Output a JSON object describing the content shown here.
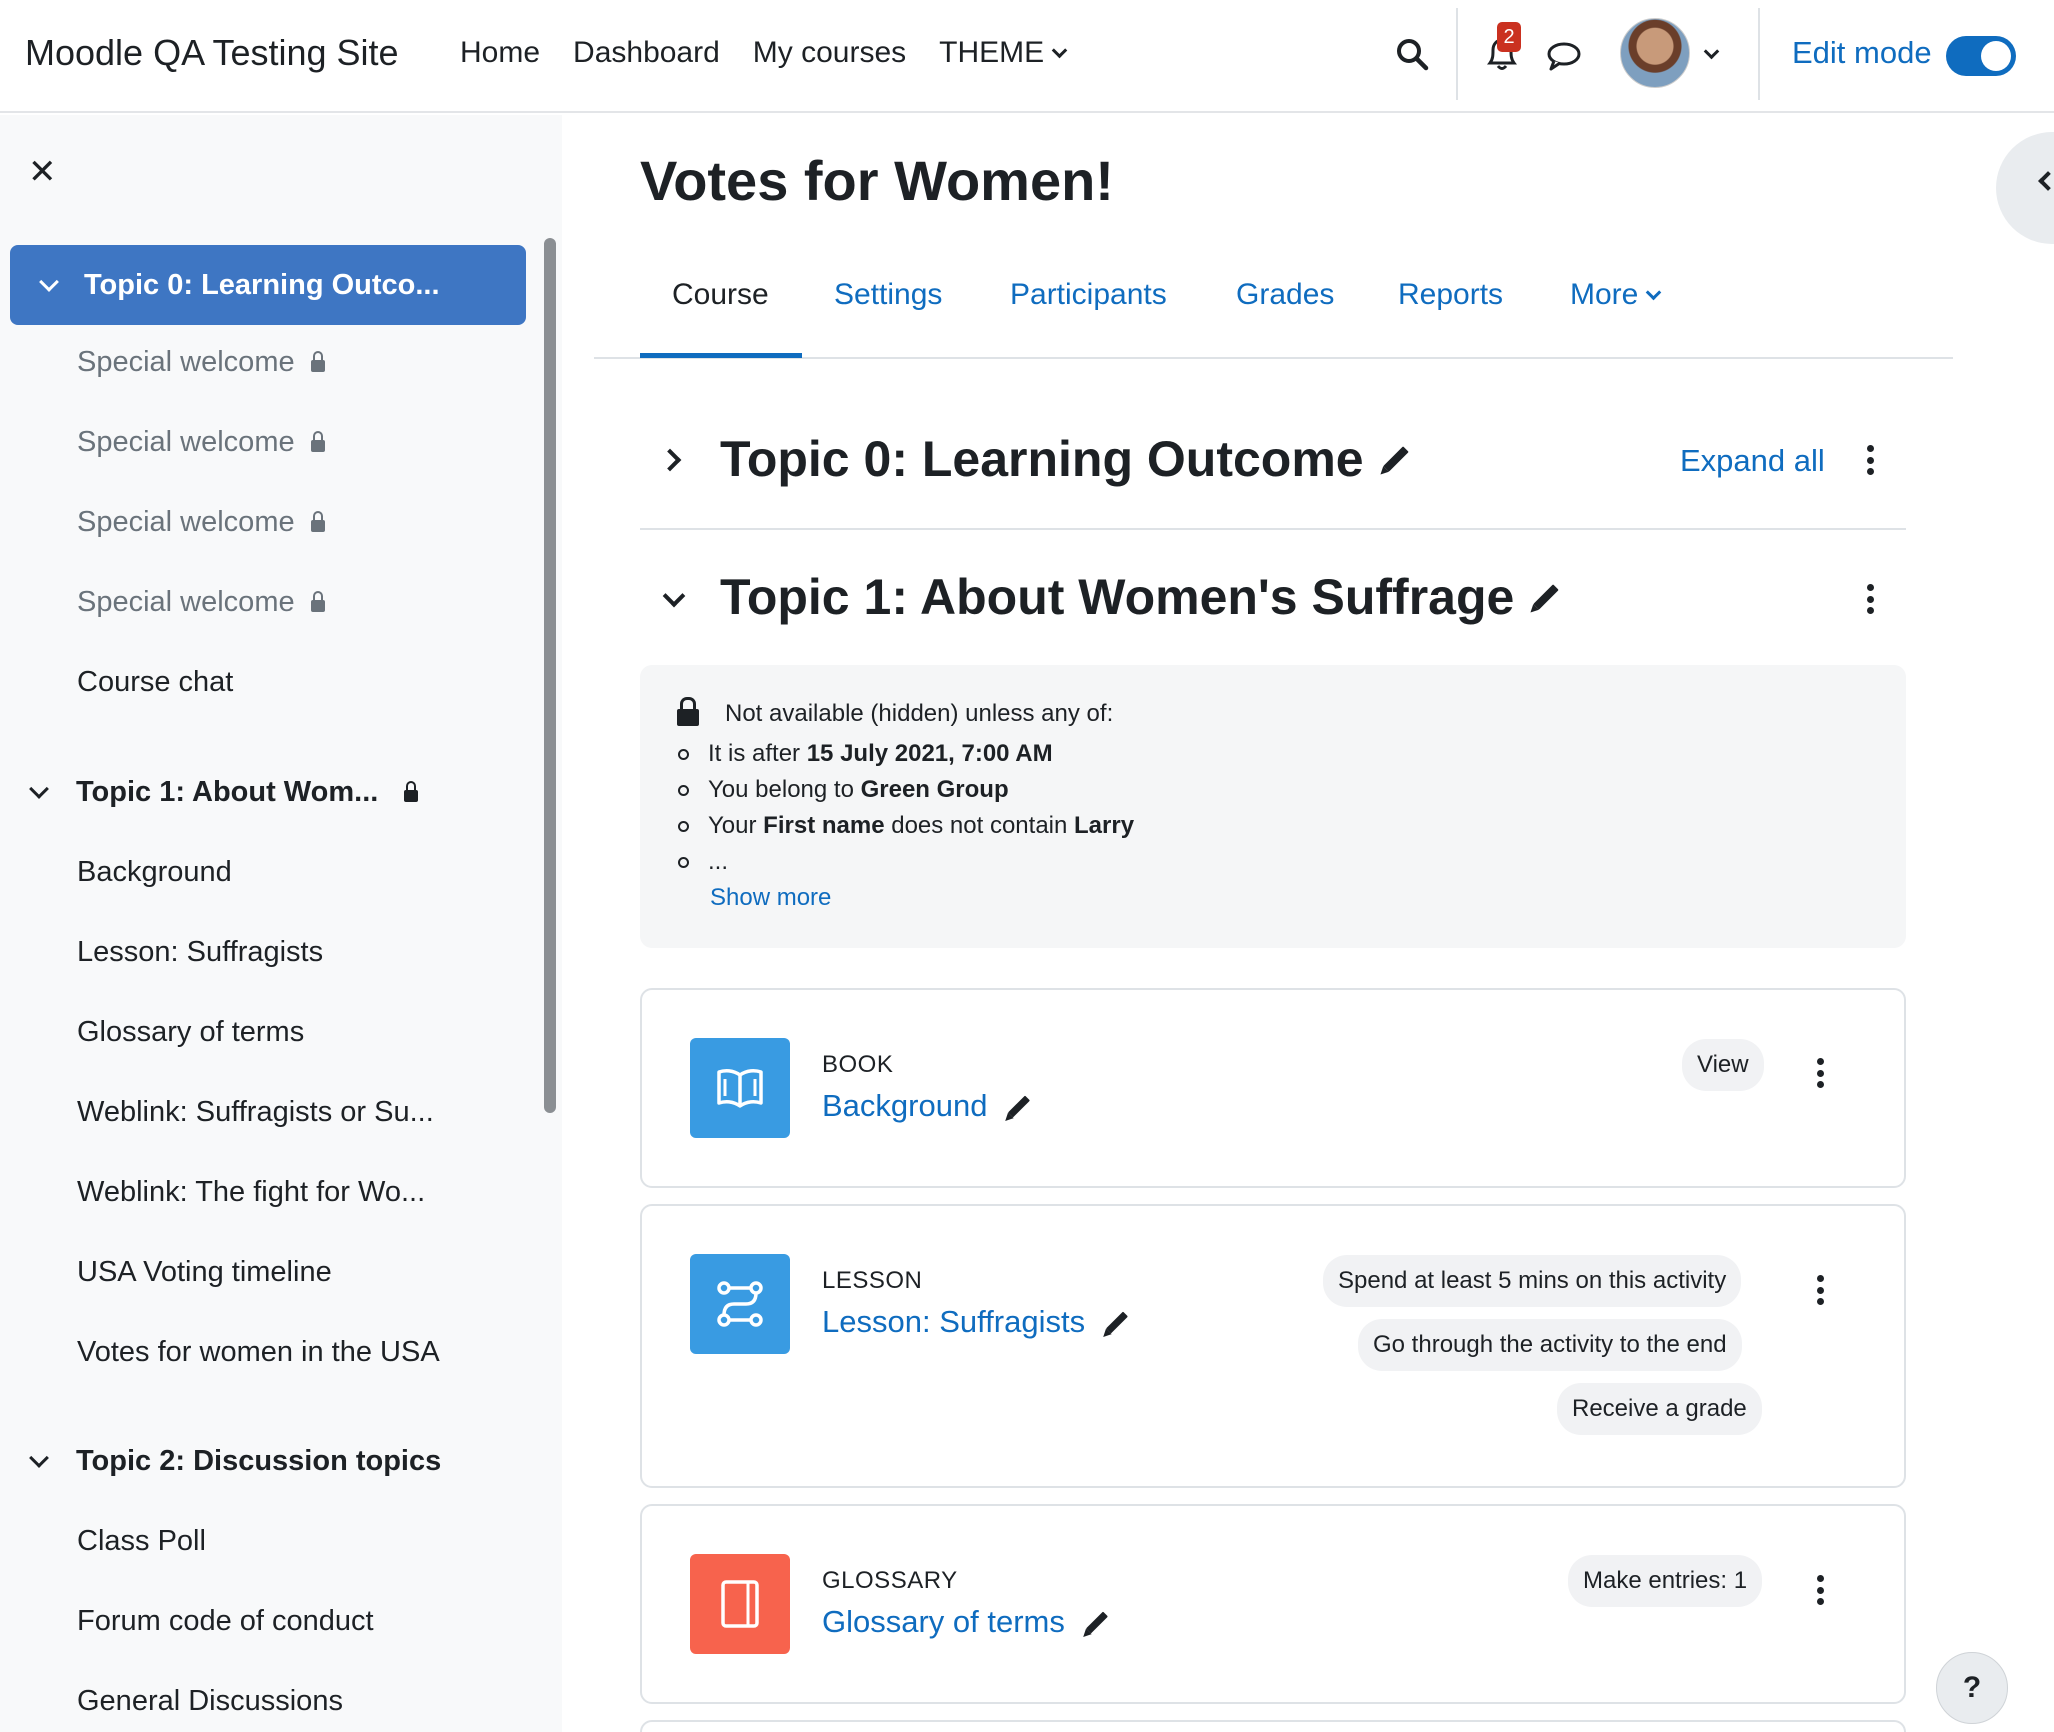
{
  "header": {
    "site_name": "Moodle QA Testing Site",
    "nav": [
      "Home",
      "Dashboard",
      "My courses",
      "THEME"
    ],
    "notification_count": "2",
    "edit_mode_label": "Edit mode"
  },
  "drawer": {
    "close_icon": "close-icon",
    "sections": [
      {
        "title": "Topic 0: Learning Outco...",
        "items": [
          {
            "label": "Special welcome",
            "locked": true
          },
          {
            "label": "Special welcome",
            "locked": true
          },
          {
            "label": "Special welcome",
            "locked": true
          },
          {
            "label": "Special welcome",
            "locked": true
          },
          {
            "label": "Course chat",
            "locked": false
          }
        ]
      },
      {
        "title": "Topic 1: About Wom...",
        "locked": true,
        "items": [
          {
            "label": "Background"
          },
          {
            "label": "Lesson: Suffragists"
          },
          {
            "label": "Glossary of terms"
          },
          {
            "label": "Weblink: Suffragists or Su..."
          },
          {
            "label": "Weblink: The fight for Wo..."
          },
          {
            "label": "USA Voting timeline"
          },
          {
            "label": "Votes for women in the USA"
          }
        ]
      },
      {
        "title": "Topic 2: Discussion topics",
        "items": [
          {
            "label": "Class Poll"
          },
          {
            "label": "Forum code of conduct"
          },
          {
            "label": "General Discussions"
          }
        ]
      }
    ]
  },
  "main": {
    "title": "Votes for Women!",
    "tabs": [
      "Course",
      "Settings",
      "Participants",
      "Grades",
      "Reports",
      "More"
    ],
    "expand_all": "Expand all",
    "topic0": {
      "title": "Topic 0: Learning Outcome"
    },
    "topic1": {
      "title": "Topic 1: About Women's Suffrage",
      "restriction": {
        "heading": "Not available (hidden) unless any of:",
        "items": [
          {
            "pre": "It is after ",
            "bold": "15 July 2021, 7:00 AM",
            "mid": "",
            "bold2": ""
          },
          {
            "pre": "You belong to ",
            "bold": "Green Group",
            "mid": "",
            "bold2": ""
          },
          {
            "pre": "Your ",
            "bold": "First name",
            "mid": " does not contain ",
            "bold2": "Larry"
          },
          {
            "pre": "...",
            "bold": "",
            "mid": "",
            "bold2": ""
          }
        ],
        "show_more": "Show more"
      }
    },
    "activities": [
      {
        "type": "BOOK",
        "name": "Background",
        "icon": "book-icon",
        "color": "#399be2",
        "conditions": [
          "View"
        ]
      },
      {
        "type": "LESSON",
        "name": "Lesson: Suffragists",
        "icon": "lesson-path-icon",
        "color": "#399be2",
        "conditions": [
          "Spend at least 5 mins on this activity",
          "Go through the activity to the end",
          "Receive a grade"
        ]
      },
      {
        "type": "GLOSSARY",
        "name": "Glossary of terms",
        "icon": "glossary-icon",
        "color": "#f7634d",
        "conditions": [
          "Make entries: 1"
        ]
      }
    ],
    "help_label": "?"
  },
  "colors": {
    "primary": "#0f6cbf",
    "active_section": "#3e76c3",
    "badge": "#ca3120"
  }
}
